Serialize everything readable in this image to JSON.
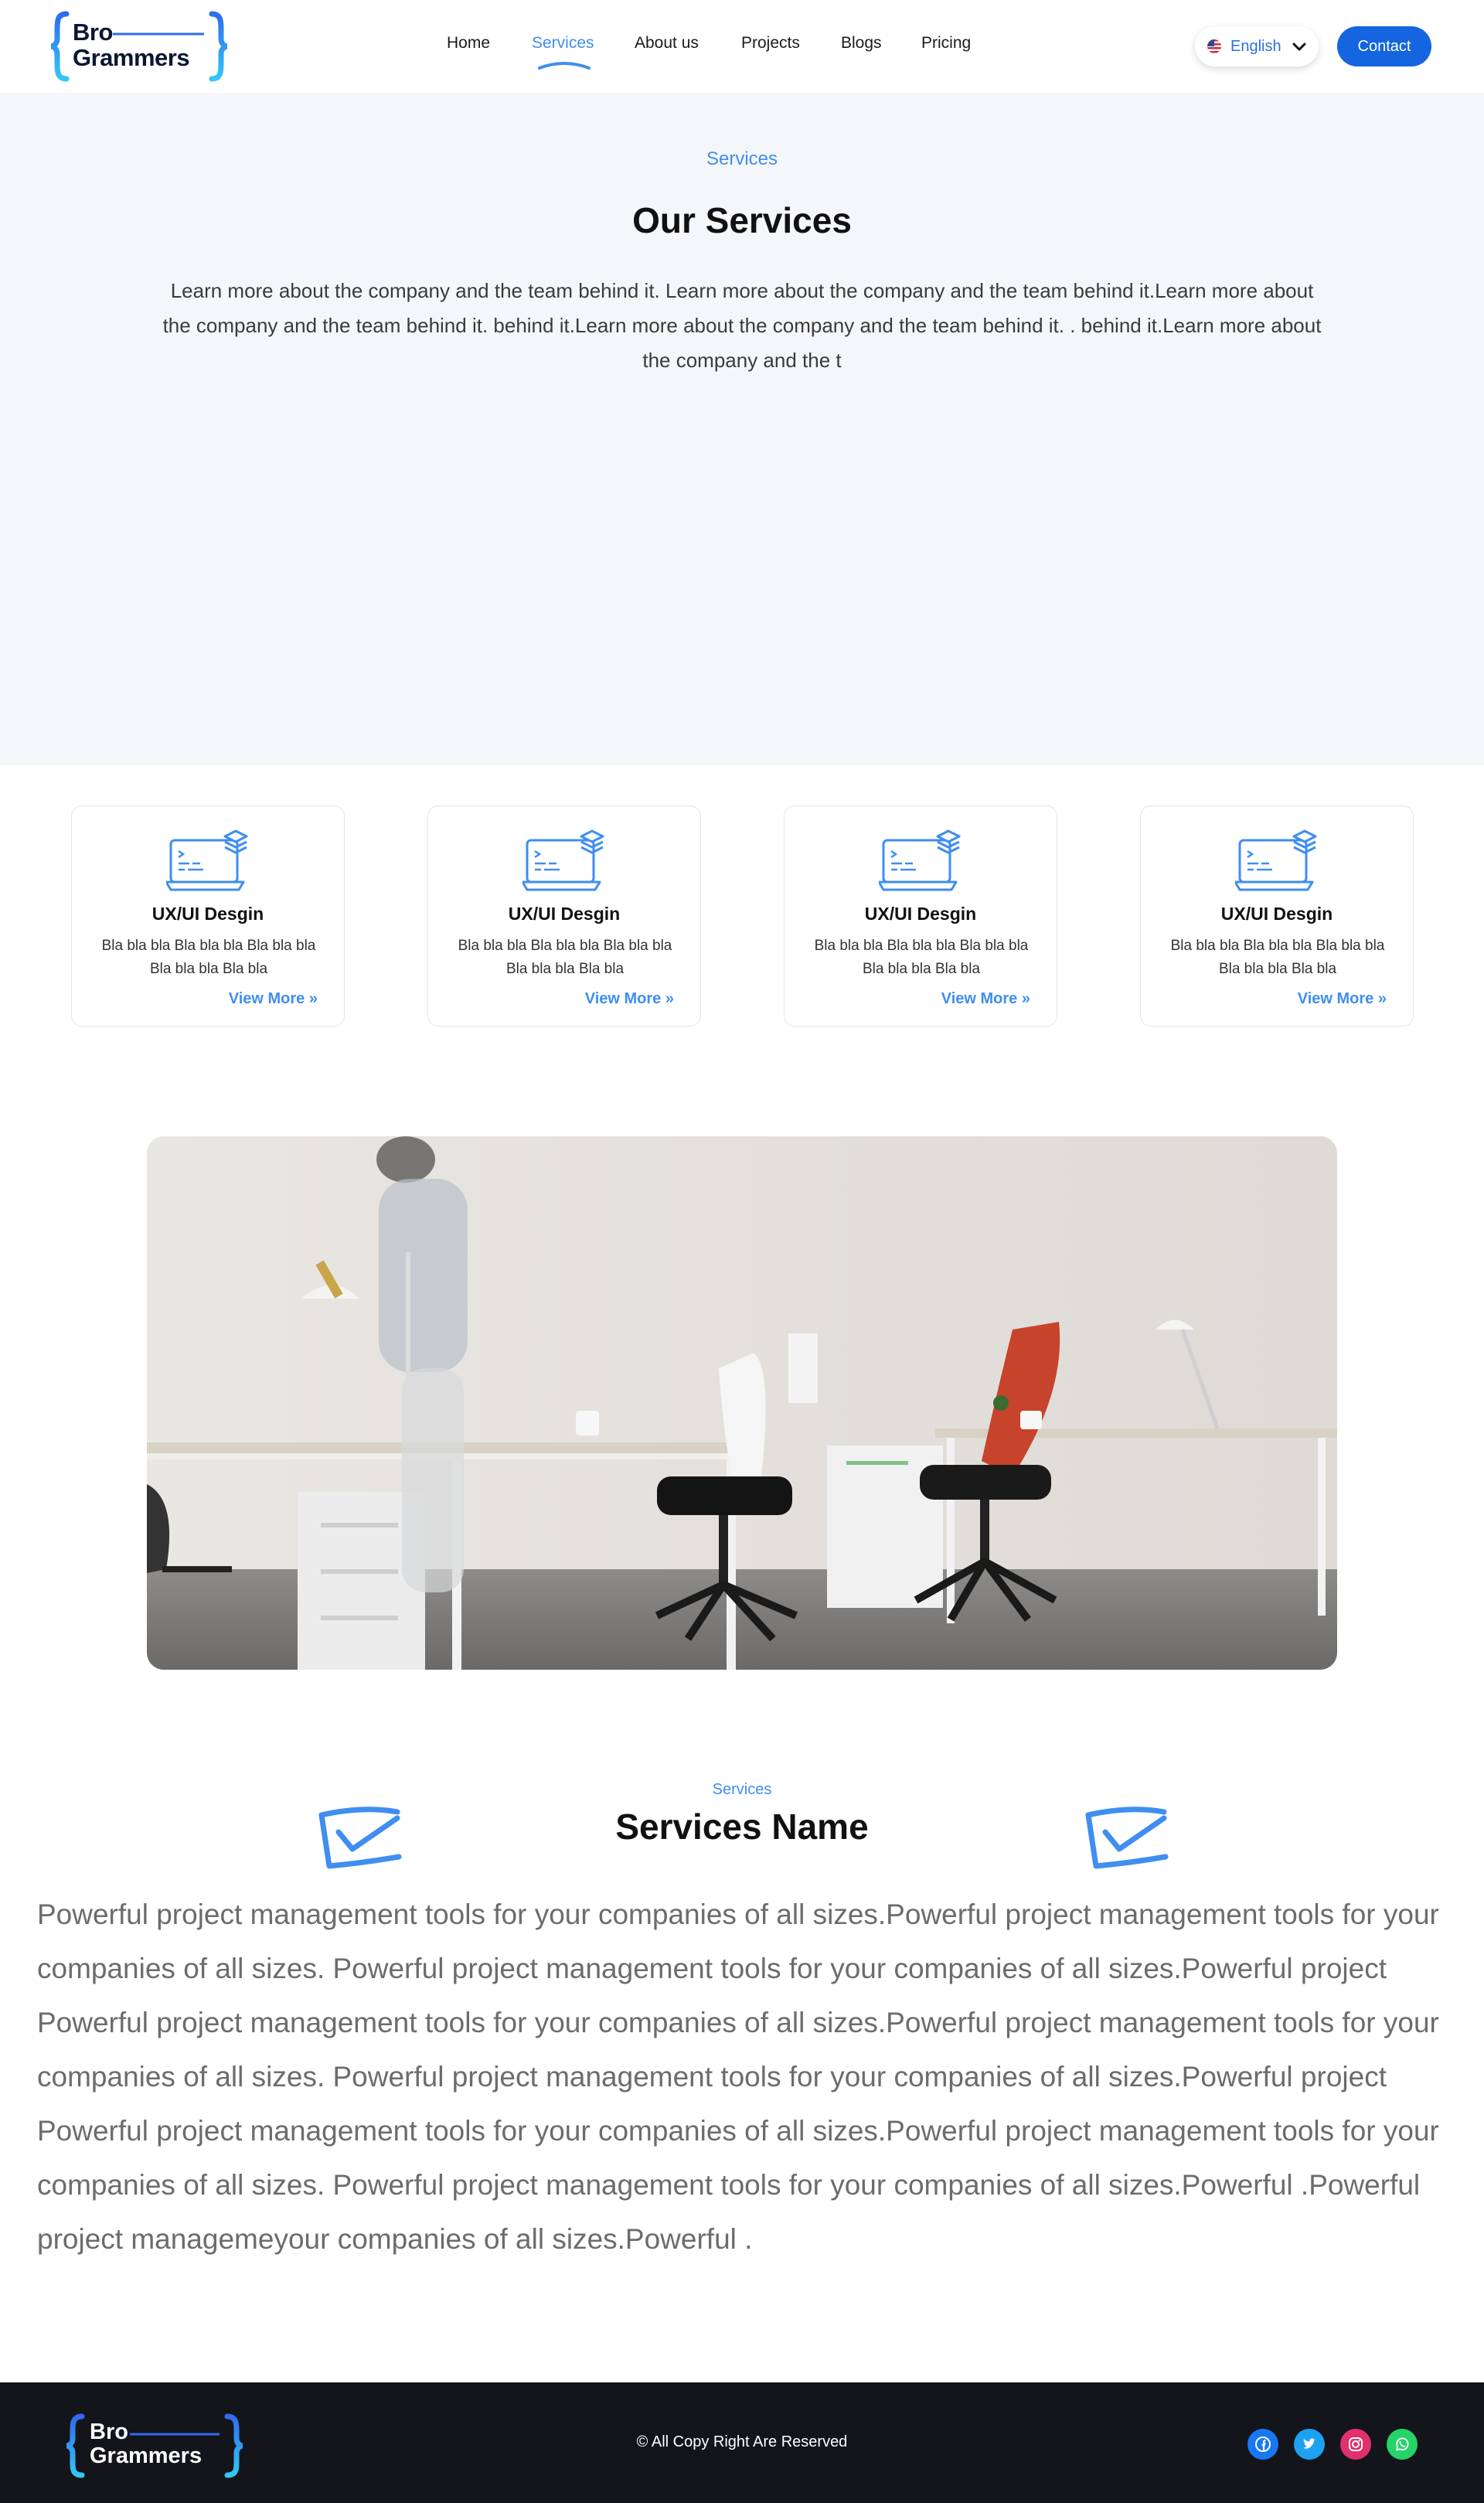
{
  "brand": {
    "line1": "Bro",
    "line2": "Grammers"
  },
  "nav": {
    "items": [
      {
        "label": "Home"
      },
      {
        "label": "Services"
      },
      {
        "label": "About us"
      },
      {
        "label": "Projects"
      },
      {
        "label": "Blogs"
      },
      {
        "label": "Pricing"
      }
    ],
    "active": "Services"
  },
  "language": {
    "label": "English",
    "flag_icon": "us-flag-icon"
  },
  "contact": {
    "label": "Contact"
  },
  "hero": {
    "kicker": "Services",
    "title": "Our Services",
    "description": "Learn more about the company and the team behind it. Learn more about the company and the team behind it.Learn more about the company and the team behind it. behind it.Learn more about the company and the team behind it. . behind it.Learn more about the company and the t"
  },
  "cards": [
    {
      "title": "UX/UI Desgin",
      "description": "Bla bla bla Bla bla bla Bla bla bla Bla bla bla Bla bla",
      "link": "View More"
    },
    {
      "title": "UX/UI Desgin",
      "description": "Bla bla bla Bla bla bla Bla bla bla Bla bla bla Bla bla",
      "link": "View More"
    },
    {
      "title": "UX/UI Desgin",
      "description": "Bla bla bla Bla bla bla Bla bla bla Bla bla bla Bla bla",
      "link": "View More"
    },
    {
      "title": "UX/UI Desgin",
      "description": "Bla bla bla Bla bla bla Bla bla bla Bla bla bla Bla bla",
      "link": "View More"
    }
  ],
  "detail": {
    "kicker": "Services",
    "title": "Services Name",
    "body": "Powerful project management tools for your companies of all sizes.Powerful project management tools for your companies of all sizes. Powerful project management tools for your companies of all sizes.Powerful project Powerful project management tools for your companies of all sizes.Powerful project management tools for your companies of all sizes. Powerful project management tools for your companies of all sizes.Powerful project Powerful project management tools for your companies of all sizes.Powerful project management tools for your companies of all sizes. Powerful project management tools for your companies of all sizes.Powerful .Powerful project managemeyour companies of all sizes.Powerful ."
  },
  "footer": {
    "copyright": "© All Copy Right Are Reserved",
    "social": [
      {
        "icon": "facebook-icon",
        "color": "#1877f2"
      },
      {
        "icon": "twitter-icon",
        "color": "#1da1f2"
      },
      {
        "icon": "instagram-icon",
        "color": "#e1306c"
      },
      {
        "icon": "whatsapp-icon",
        "color": "#25d366"
      }
    ]
  },
  "colors": {
    "accent": "#3f8ef0",
    "primary_button": "#1565e0",
    "footer_bg": "#14151a",
    "hero_bg": "#f5f6fa"
  }
}
